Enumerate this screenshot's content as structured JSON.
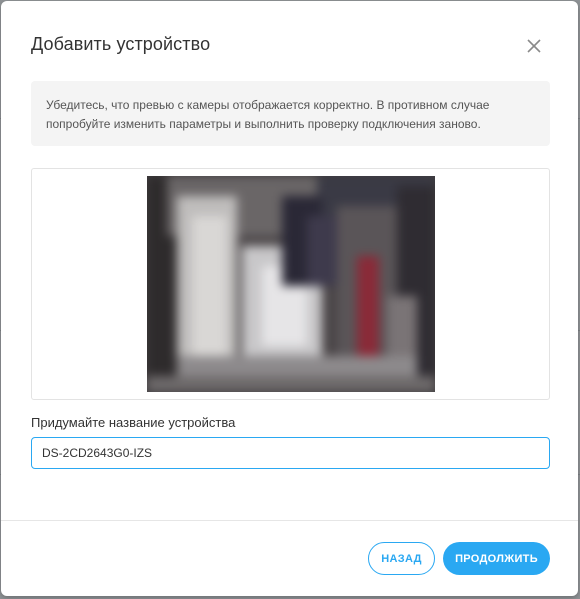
{
  "dialog": {
    "title": "Добавить устройство",
    "close_icon": "close-icon",
    "notice": "Убедитесь, что превью с камеры отображается корректно. В противном случае попробуйте изменить параметры и выполнить проверку подключения заново.",
    "name_label": "Придумайте название устройства",
    "name_value": "DS-2CD2643G0-IZS",
    "back_label": "НАЗАД",
    "next_label": "ПРОДОЛЖИТЬ"
  },
  "colors": {
    "accent": "#2aa8f2",
    "notice_bg": "#f4f4f4"
  }
}
